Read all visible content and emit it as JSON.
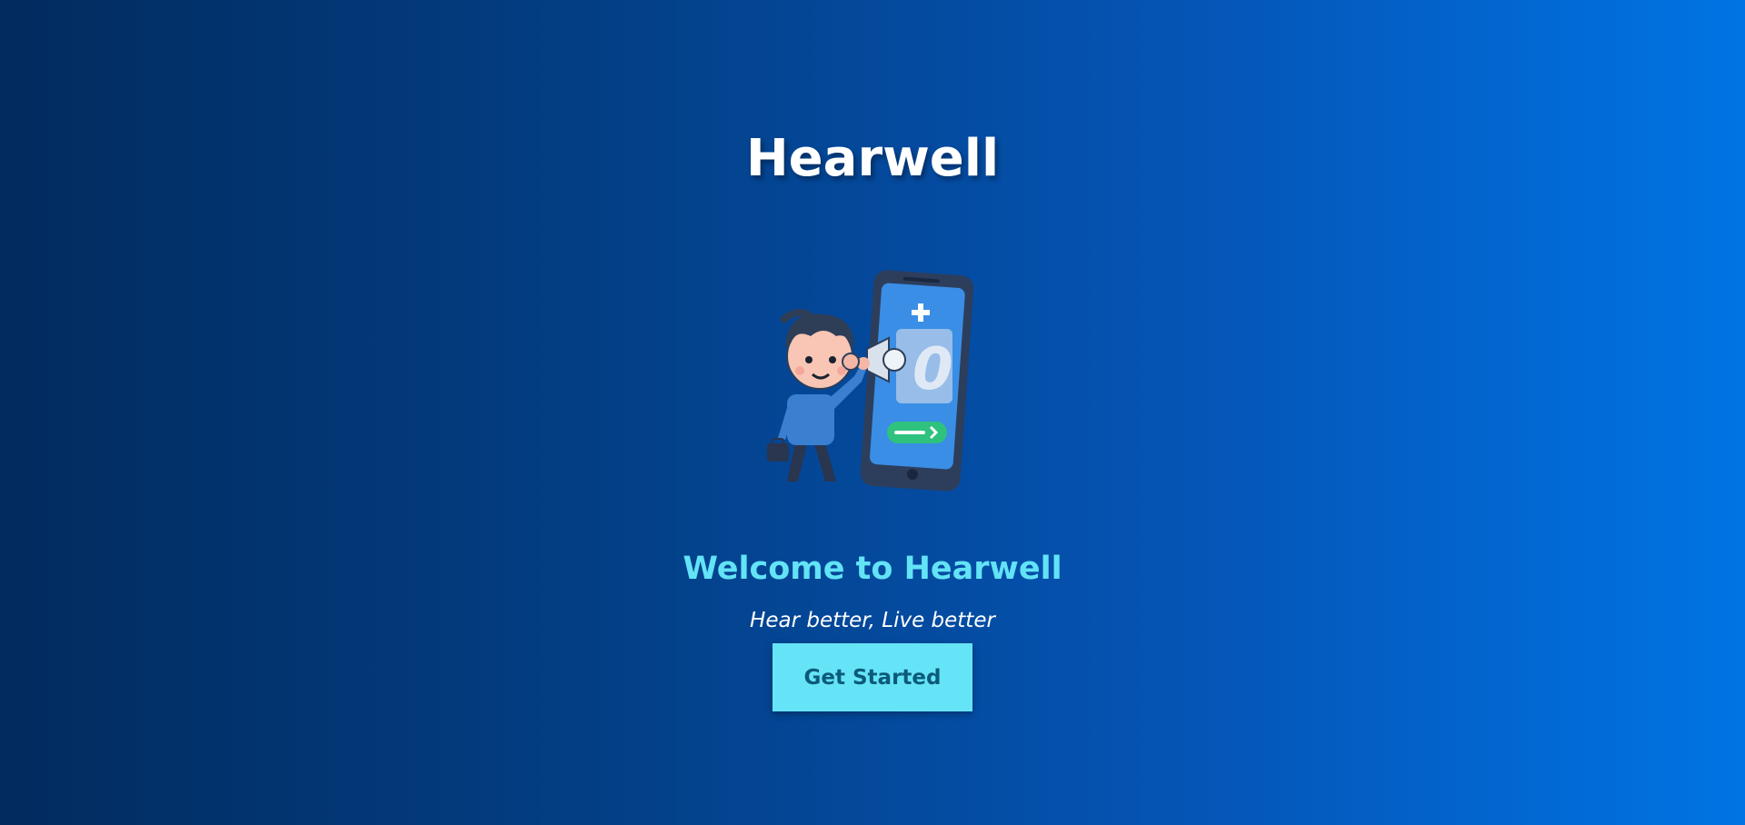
{
  "header": {
    "title": "Hearwell"
  },
  "hero": {
    "illustration_icon": "person-with-hearing-aid-and-phone-illustration",
    "welcome": "Welcome to Hearwell",
    "tagline": "Hear better, Live better",
    "cta_label": "Get Started"
  },
  "colors": {
    "background_start": "#022b5e",
    "background_end": "#0074e4",
    "title": "#ffffff",
    "welcome": "#62e3f6",
    "cta_bg": "#66e4f7",
    "cta_text": "#0b5a7c"
  }
}
